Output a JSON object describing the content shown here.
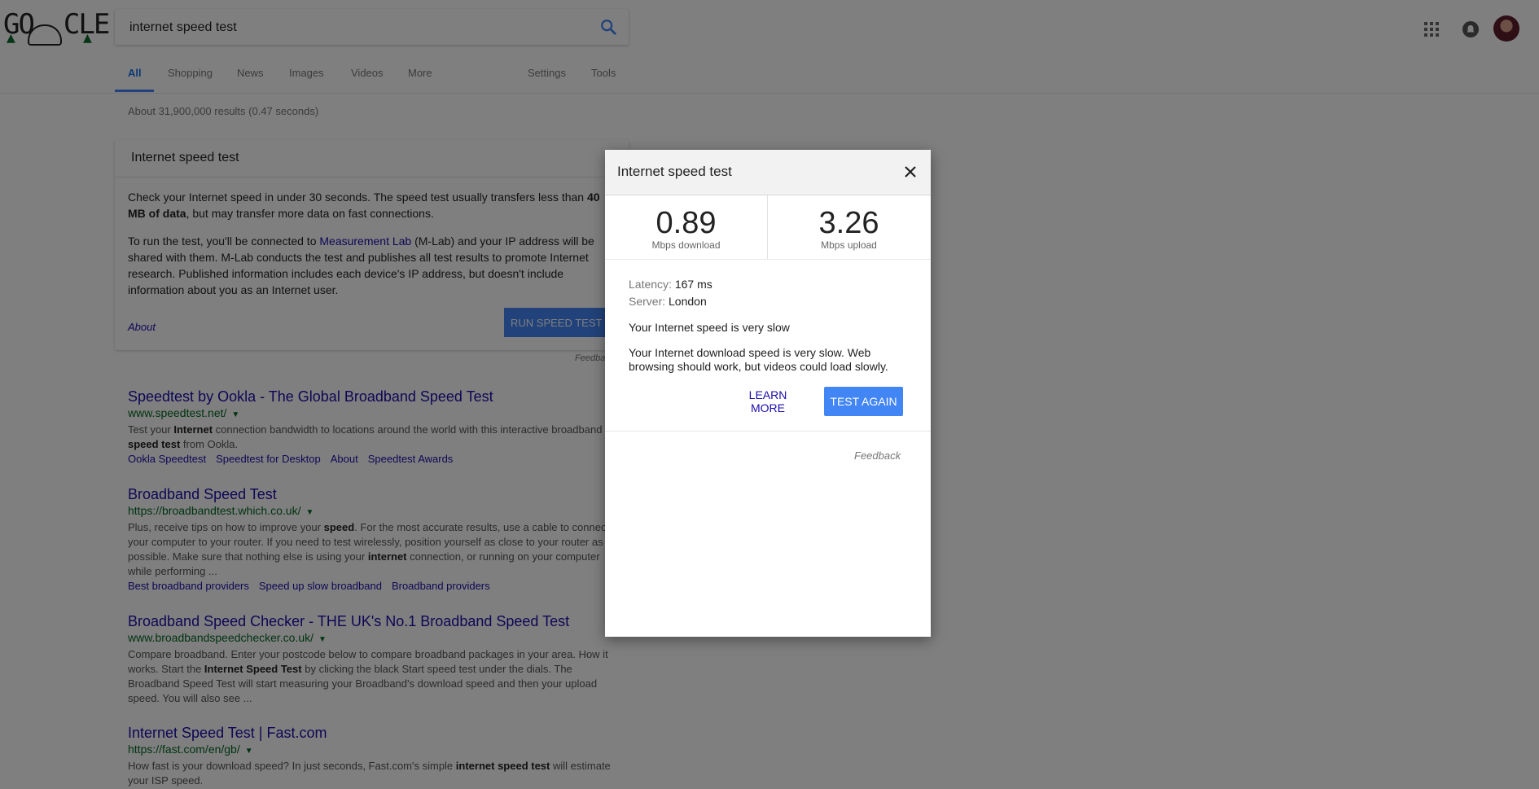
{
  "header": {
    "logo_text": "GO  CLE",
    "search_value": "internet speed test",
    "icons": [
      "search-icon",
      "apps-icon",
      "notifications-icon",
      "avatar"
    ]
  },
  "tabs": [
    {
      "label": "All",
      "active": true
    },
    {
      "label": "Shopping"
    },
    {
      "label": "News"
    },
    {
      "label": "Images"
    },
    {
      "label": "Videos"
    },
    {
      "label": "More"
    },
    {
      "label": "Settings"
    },
    {
      "label": "Tools"
    }
  ],
  "stats": "About 31,900,000 results (0.47 seconds)",
  "speed_card": {
    "title": "Internet speed test",
    "p1_pre": "Check your Internet speed in under 30 seconds. The speed test usually transfers less than ",
    "p1_bold": "40 MB of data",
    "p1_post": ", but may transfer more data on fast connections.",
    "p2_pre": "To run the test, you'll be connected to ",
    "p2_link": "Measurement Lab",
    "p2_post": " (M-Lab) and your IP address will be shared with them. M-Lab conducts the test and publishes all test results to promote Internet research. Published information includes each device's IP address, but doesn't include information about you as an Internet user.",
    "about": "About",
    "run_button": "RUN SPEED TEST",
    "feedback": "Feedback"
  },
  "results": [
    {
      "title": "Speedtest by Ookla - The Global Broadband Speed Test",
      "url": "www.speedtest.net/",
      "snippet_parts": [
        "Test your ",
        "Internet",
        " connection bandwidth to locations around the world with this interactive broadband ",
        "speed test",
        " from Ookla."
      ],
      "links": [
        "Ookla Speedtest",
        "Speedtest for Desktop",
        "About",
        "Speedtest Awards"
      ]
    },
    {
      "title": "Broadband Speed Test",
      "url": "https://broadbandtest.which.co.uk/",
      "snippet_parts": [
        "Plus, receive tips on how to improve your ",
        "speed",
        ". For the most accurate results, use a cable to connect your computer to your router. If you need to test wirelessly, position yourself as close to your router as possible. Make sure that nothing else is using your ",
        "internet",
        " connection, or running on your computer while performing ..."
      ],
      "links": [
        "Best broadband providers",
        "Speed up slow broadband",
        "Broadband providers"
      ]
    },
    {
      "title": "Broadband Speed Checker - THE UK's No.1 Broadband Speed Test",
      "url": "www.broadbandspeedchecker.co.uk/",
      "snippet_parts": [
        "Compare broadband. Enter your postcode below to compare broadband packages in your area. How it works. Start the ",
        "Internet Speed Test",
        " by clicking the black Start speed test under the dials. The Broadband Speed Test will start measuring your Broadband's download speed and then your upload speed. You will also see ..."
      ],
      "links": []
    },
    {
      "title": "Internet Speed Test | Fast.com",
      "url": "https://fast.com/en/gb/",
      "snippet_parts": [
        "How fast is your download speed? In just seconds, Fast.com's simple ",
        "internet speed test",
        " will estimate your ISP speed."
      ],
      "links": []
    }
  ],
  "dialog": {
    "title": "Internet speed test",
    "download_value": "0.89",
    "download_unit": "Mbps download",
    "upload_value": "3.26",
    "upload_unit": "Mbps upload",
    "latency_label": "Latency:",
    "latency_value": "167 ms",
    "server_label": "Server:",
    "server_value": "London",
    "verdict": "Your Internet speed is very slow",
    "explanation": "Your Internet download speed is very slow. Web browsing should work, but videos could load slowly.",
    "learn_more": "LEARN MORE",
    "test_again": "TEST AGAIN",
    "feedback": "Feedback"
  },
  "colors": {
    "accent": "#4285f4",
    "link": "#1a0dab",
    "url": "#006621",
    "overlay": "rgba(0,0,0,0.5)"
  }
}
